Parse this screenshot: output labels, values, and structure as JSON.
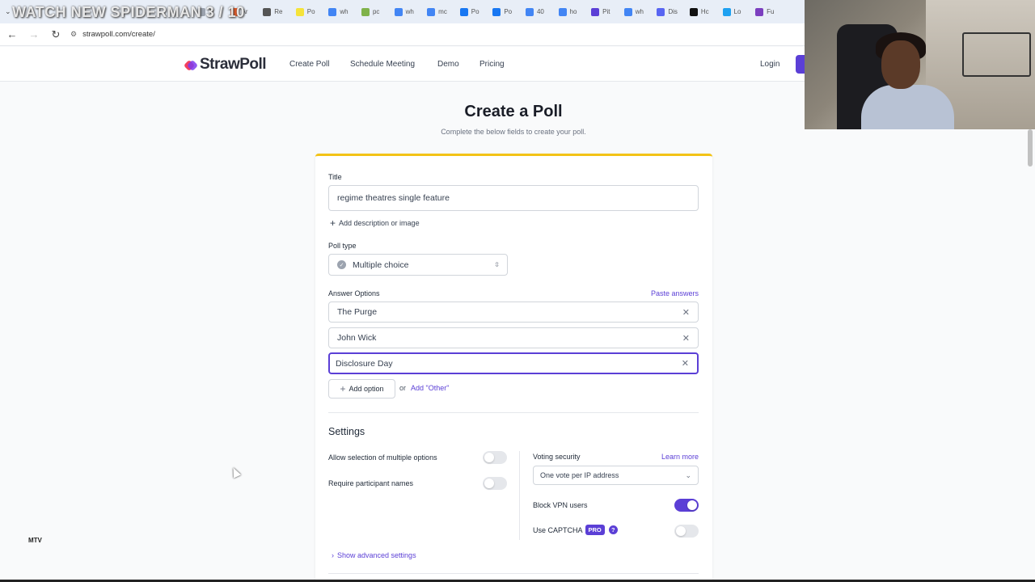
{
  "browser": {
    "overlay_text": "WATCH NEW SPIDERMAN 3 / 10",
    "tabs": [
      {
        "label": "Ti",
        "color": "#9ca3af"
      },
      {
        "label": "Ar",
        "color": "#ef5a24"
      },
      {
        "label": "Re",
        "color": "#555555"
      },
      {
        "label": "Po",
        "color": "#f5e33a"
      },
      {
        "label": "wh",
        "color": "#4285f4"
      },
      {
        "label": "pc",
        "color": "#7fb24a"
      },
      {
        "label": "wh",
        "color": "#4285f4"
      },
      {
        "label": "mc",
        "color": "#4285f4"
      },
      {
        "label": "Po",
        "color": "#1877f2"
      },
      {
        "label": "Po",
        "color": "#1877f2"
      },
      {
        "label": "40",
        "color": "#4285f4"
      },
      {
        "label": "ho",
        "color": "#4285f4"
      },
      {
        "label": "Pit",
        "color": "#5b3fd6"
      },
      {
        "label": "wh",
        "color": "#4285f4"
      },
      {
        "label": "Dis",
        "color": "#5865f2"
      },
      {
        "label": "Hc",
        "color": "#111111"
      },
      {
        "label": "Lo",
        "color": "#1ea1f1"
      },
      {
        "label": "Fu",
        "color": "#7b3fbf"
      }
    ],
    "url": "strawpoll.com/create/"
  },
  "header": {
    "logo_text": "StrawPoll",
    "nav": [
      "Create Poll",
      "Schedule Meeting",
      "Demo",
      "Pricing"
    ],
    "login": "Login"
  },
  "page": {
    "title": "Create a Poll",
    "subtitle": "Complete the below fields to create your poll."
  },
  "form": {
    "title_label": "Title",
    "title_value": "regime theatres single feature",
    "add_description": "Add description or image",
    "poll_type_label": "Poll type",
    "poll_type_value": "Multiple choice",
    "answer_options_label": "Answer Options",
    "paste_answers": "Paste answers",
    "options": [
      "The Purge",
      "John Wick",
      "Disclosure Day"
    ],
    "add_option": "Add option",
    "or_text": "or",
    "add_other": "Add \"Other\""
  },
  "settings": {
    "title": "Settings",
    "allow_multiple": "Allow selection of multiple options",
    "allow_multiple_on": false,
    "require_names": "Require participant names",
    "require_names_on": false,
    "voting_security_label": "Voting security",
    "learn_more": "Learn more",
    "voting_security_value": "One vote per IP address",
    "block_vpn": "Block VPN users",
    "block_vpn_on": true,
    "use_captcha": "Use CAPTCHA",
    "pro_badge": "PRO",
    "help_mark": "?",
    "use_captcha_on": false,
    "show_advanced": "Show advanced settings"
  },
  "misc": {
    "mini_logo": "MTV"
  },
  "colors": {
    "accent": "#5b3fd6",
    "card_top": "#f3c316"
  }
}
